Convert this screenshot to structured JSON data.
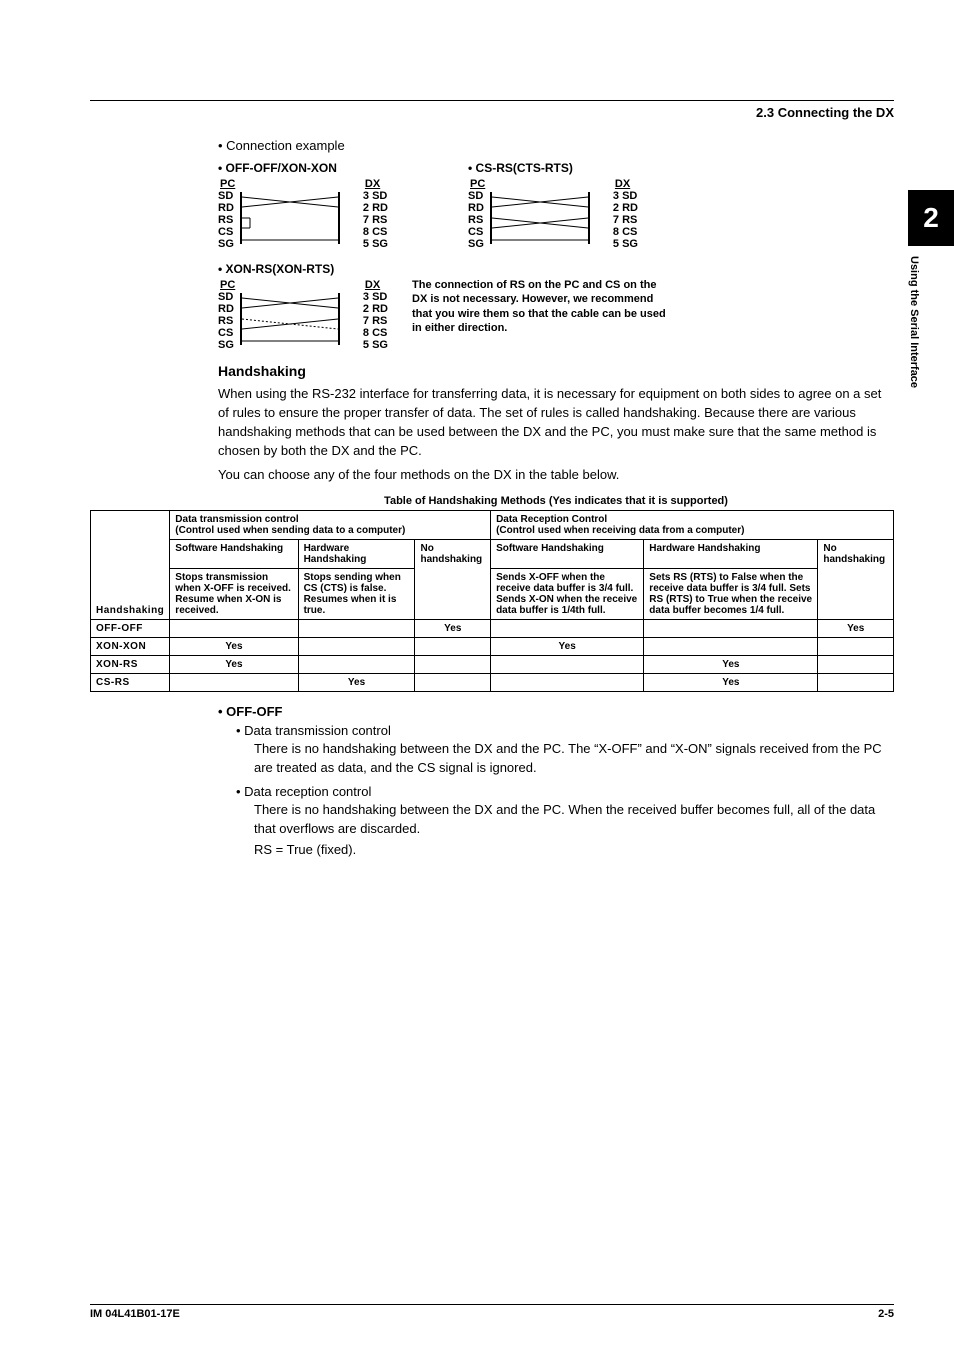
{
  "header": {
    "section": "2.3  Connecting the DX"
  },
  "sidetab": {
    "number": "2",
    "label": "Using the Serial Interface"
  },
  "conn_example": "•   Connection example",
  "diagrams": {
    "d1": {
      "title": "• OFF-OFF/XON-XON",
      "pc": "PC",
      "dx": "DX",
      "pins_left": [
        "SD",
        "RD",
        "RS",
        "CS",
        "SG"
      ],
      "pins_right": [
        "3  SD",
        "2  RD",
        "7  RS",
        "8  CS",
        "5  SG"
      ]
    },
    "d2": {
      "title": "• CS-RS(CTS-RTS)",
      "pc": "PC",
      "dx": "DX",
      "pins_left": [
        "SD",
        "RD",
        "RS",
        "CS",
        "SG"
      ],
      "pins_right": [
        "3  SD",
        "2  RD",
        "7  RS",
        "8  CS",
        "5  SG"
      ]
    },
    "d3": {
      "title": "• XON-RS(XON-RTS)",
      "pc": "PC",
      "dx": "DX",
      "pins_left": [
        "SD",
        "RD",
        "RS",
        "CS",
        "SG"
      ],
      "pins_right": [
        "3  SD",
        "2  RD",
        "7  RS",
        "8  CS",
        "5  SG"
      ]
    },
    "note": "The connection of RS on the PC and CS on the DX is not necessary.  However, we recommend that you wire them so that the cable can be used in either direction."
  },
  "handshaking": {
    "title": "Handshaking",
    "p1": "When using the RS-232 interface for transferring data, it is necessary for equipment on both sides to agree on a set of rules to ensure the proper transfer of data. The set of rules is called handshaking. Because there are various handshaking methods that can be used between the DX and the PC, you must make sure that the same method is chosen by both the DX and the PC.",
    "p2": "You can choose any of the four methods on the DX in the table below.",
    "table_caption": "Table of Handshaking Methods (Yes indicates that it is supported)"
  },
  "table": {
    "h_dtx": "Data transmission control",
    "h_dtx_sub": "(Control used when sending data to a computer)",
    "h_drx": "Data Reception Control",
    "h_drx_sub": "(Control used when receiving data from a computer)",
    "sw_hs": "Software Handshaking",
    "hw_hs": "Hardware Handshaking",
    "no_hs": "No handshaking",
    "row_label": "Handshaking",
    "tx_sw": "Stops transmission when X-OFF is received. Resume when X-ON is received.",
    "tx_hw": "Stops sending when CS (CTS) is false.  Resumes when it is true.",
    "rx_sw": "Sends X-OFF when the receive data buffer is 3/4 full.  Sends X-ON when the receive data buffer is 1/4th full.",
    "rx_hw": "Sets RS (RTS) to False when the receive data buffer is 3/4 full.  Sets RS (RTS) to True when the receive data buffer becomes 1/4 full.",
    "rows": {
      "r1": "OFF-OFF",
      "r2": "XON-XON",
      "r3": "XON-RS",
      "r4": "CS-RS"
    },
    "yes": "Yes"
  },
  "offoff": {
    "title": "•   OFF-OFF",
    "b1": "•   Data transmission control",
    "b1_body": "There is no handshaking between the DX and the PC. The “X-OFF” and “X-ON” signals received from the PC are treated as data, and the CS signal is ignored.",
    "b2": "•   Data reception control",
    "b2_body1": "There is no handshaking between the DX and the PC. When the received buffer becomes full, all of the data that overflows are discarded.",
    "b2_body2": "RS = True (fixed)."
  },
  "footer": {
    "doc": "IM 04L41B01-17E",
    "page": "2-5"
  }
}
